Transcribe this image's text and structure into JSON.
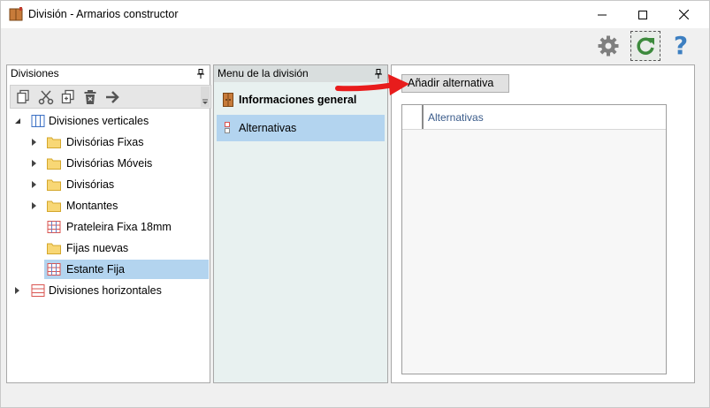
{
  "window": {
    "title": "División - Armarios constructor",
    "controls": [
      "minimize",
      "maximize",
      "close"
    ]
  },
  "toolbar": {
    "buttons": [
      {
        "name": "settings",
        "icon": "gear-icon"
      },
      {
        "name": "refresh",
        "icon": "refresh-icon",
        "active": true
      },
      {
        "name": "help",
        "icon": "help-icon",
        "glyph": "?"
      }
    ]
  },
  "divisiones_panel": {
    "title": "Divisiones",
    "actions": [
      "copy-icon",
      "cut-icon",
      "duplicate-icon",
      "delete-icon",
      "arrow-right-icon"
    ],
    "tree": [
      {
        "label": "Divisiones verticales",
        "level": 0,
        "expanded": true,
        "icon": "vertical-divisions-icon"
      },
      {
        "label": "Divisórias Fixas",
        "level": 1,
        "expandable": true,
        "icon": "folder-icon"
      },
      {
        "label": "Divisórias Móveis",
        "level": 1,
        "expandable": true,
        "icon": "folder-icon"
      },
      {
        "label": "Divisórias",
        "level": 1,
        "expandable": true,
        "icon": "folder-icon"
      },
      {
        "label": "Montantes",
        "level": 1,
        "expandable": true,
        "icon": "folder-icon"
      },
      {
        "label": "Prateleira Fixa 18mm",
        "level": 1,
        "expandable": false,
        "icon": "grid-icon"
      },
      {
        "label": "Fijas nuevas",
        "level": 1,
        "expandable": false,
        "icon": "folder-icon"
      },
      {
        "label": "Estante Fija",
        "level": 1,
        "expandable": false,
        "icon": "grid-icon",
        "selected": true
      },
      {
        "label": "Divisiones horizontales",
        "level": 0,
        "expanded": false,
        "icon": "horizontal-divisions-icon"
      }
    ]
  },
  "menu_panel": {
    "title": "Menu de la división",
    "items": [
      {
        "label": "Informaciones general",
        "bold": true,
        "icon": "info-icon"
      },
      {
        "label": "Alternativas",
        "bold": false,
        "icon": "alternatives-icon",
        "selected": true
      }
    ]
  },
  "main_panel": {
    "add_button": "Añadir alternativa",
    "grid_column": "Alternativas"
  },
  "colors": {
    "selection": "#b3d4ef",
    "menu_background": "#e8f1f0",
    "refresh_green": "#3c8a3c",
    "help_blue": "#3d7fc1",
    "annotation_red": "#e81c1c"
  }
}
